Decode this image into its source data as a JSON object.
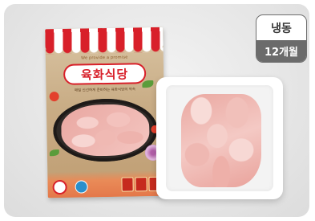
{
  "product": {
    "brand_name": "육화식당",
    "package_slogan": "We provide a promise",
    "package_subtext": "매일 신선하게 준비하는 육화식당의 약속",
    "logo_icon": "chef-icon",
    "awning_colors": [
      "#d8202a",
      "#ffffff"
    ]
  },
  "info": {
    "storage_label": "냉동",
    "shelf_life_label": "12개월",
    "border_color": "#6e6e6e",
    "bottom_bg_color": "#6b6b6b"
  }
}
